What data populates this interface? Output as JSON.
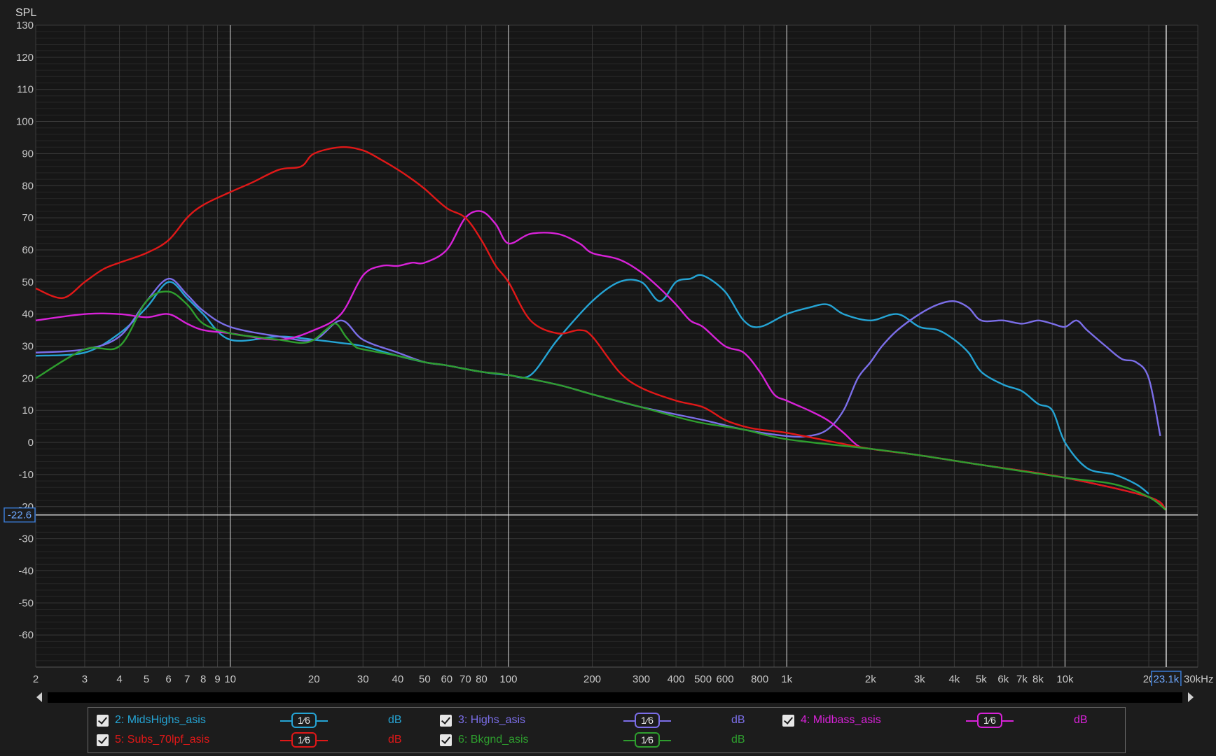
{
  "axis_label": "SPL",
  "cursor": {
    "y_readout": "-22.6",
    "x_readout": "23.1k",
    "y": -22.6,
    "x": 23100
  },
  "chart_data": {
    "type": "line",
    "title": "",
    "xlabel": "",
    "ylabel": "SPL",
    "x_scale": "log",
    "xlim": [
      2,
      30000
    ],
    "ylim": [
      -70,
      130
    ],
    "grid": true,
    "y_ticks": [
      130,
      120,
      110,
      100,
      90,
      80,
      70,
      60,
      50,
      40,
      30,
      20,
      10,
      0,
      -10,
      -20,
      -30,
      -40,
      -50,
      -60
    ],
    "x_ticks": [
      {
        "v": 2,
        "t": "2"
      },
      {
        "v": 3,
        "t": "3"
      },
      {
        "v": 4,
        "t": "4"
      },
      {
        "v": 5,
        "t": "5"
      },
      {
        "v": 6,
        "t": "6"
      },
      {
        "v": 7,
        "t": "7"
      },
      {
        "v": 8,
        "t": "8"
      },
      {
        "v": 9,
        "t": "9"
      },
      {
        "v": 10,
        "t": "10"
      },
      {
        "v": 20,
        "t": "20"
      },
      {
        "v": 30,
        "t": "30"
      },
      {
        "v": 40,
        "t": "40"
      },
      {
        "v": 50,
        "t": "50"
      },
      {
        "v": 60,
        "t": "60"
      },
      {
        "v": 70,
        "t": "70"
      },
      {
        "v": 80,
        "t": "80"
      },
      {
        "v": 100,
        "t": "100"
      },
      {
        "v": 200,
        "t": "200"
      },
      {
        "v": 300,
        "t": "300"
      },
      {
        "v": 400,
        "t": "400"
      },
      {
        "v": 500,
        "t": "500"
      },
      {
        "v": 600,
        "t": "600"
      },
      {
        "v": 800,
        "t": "800"
      },
      {
        "v": 1000,
        "t": "1k"
      },
      {
        "v": 2000,
        "t": "2k"
      },
      {
        "v": 3000,
        "t": "3k"
      },
      {
        "v": 4000,
        "t": "4k"
      },
      {
        "v": 5000,
        "t": "5k"
      },
      {
        "v": 6000,
        "t": "6k"
      },
      {
        "v": 7000,
        "t": "7k"
      },
      {
        "v": 8000,
        "t": "8k"
      },
      {
        "v": 10000,
        "t": "10k"
      },
      {
        "v": 20000,
        "t": "20"
      },
      {
        "v": 30000,
        "t": "30kHz"
      }
    ],
    "series": [
      {
        "name": "2: MidsHighs_asis",
        "color": "#25a4d4",
        "x": [
          2,
          3,
          4,
          5,
          6,
          7,
          8,
          10,
          15,
          20,
          25,
          30,
          40,
          50,
          60,
          80,
          100,
          120,
          150,
          200,
          250,
          300,
          350,
          400,
          450,
          500,
          600,
          700,
          800,
          1000,
          1200,
          1400,
          1600,
          2000,
          2500,
          3000,
          3500,
          4000,
          4500,
          5000,
          6000,
          7000,
          8000,
          9000,
          10000,
          12000,
          15000,
          18000,
          20000
        ],
        "y": [
          27,
          28,
          34,
          42,
          50,
          45,
          40,
          32,
          33,
          32,
          31,
          30,
          27,
          25,
          24,
          22,
          21,
          21,
          32,
          44,
          50,
          50,
          44,
          50,
          51,
          52,
          47,
          38,
          36,
          40,
          42,
          43,
          40,
          38,
          40,
          36,
          35,
          32,
          28,
          22,
          18,
          16,
          12,
          10,
          0,
          -8,
          -10,
          -13,
          -16
        ]
      },
      {
        "name": "3: Highs_asis",
        "color": "#7b6ee8",
        "x": [
          2,
          3,
          4,
          5,
          6,
          7,
          8,
          10,
          15,
          20,
          25,
          30,
          40,
          50,
          60,
          80,
          100,
          150,
          200,
          300,
          500,
          700,
          1000,
          1200,
          1400,
          1600,
          1800,
          2000,
          2200,
          2500,
          3000,
          3500,
          4000,
          4500,
          5000,
          6000,
          7000,
          8000,
          9000,
          10000,
          11000,
          12000,
          14000,
          16000,
          18000,
          20000,
          22000
        ],
        "y": [
          28,
          29,
          33,
          44,
          51,
          46,
          41,
          36,
          33,
          32,
          38,
          32,
          28,
          25,
          24,
          22,
          21,
          18,
          15,
          11,
          7,
          4,
          2,
          2,
          4,
          10,
          20,
          25,
          30,
          35,
          40,
          43,
          44,
          42,
          38,
          38,
          37,
          38,
          37,
          36,
          38,
          35,
          30,
          26,
          25,
          20,
          2
        ]
      },
      {
        "name": "4: Midbass_asis",
        "color": "#d822d8",
        "x": [
          2,
          3,
          4,
          5,
          6,
          7,
          8,
          10,
          15,
          20,
          25,
          30,
          35,
          40,
          45,
          50,
          60,
          70,
          80,
          90,
          100,
          120,
          150,
          180,
          200,
          250,
          300,
          350,
          400,
          450,
          500,
          600,
          700,
          800,
          900,
          1000,
          1200,
          1400,
          1600,
          1800,
          2000,
          3000,
          5000,
          10000,
          20000,
          23000
        ],
        "y": [
          38,
          40,
          40,
          39,
          40,
          37,
          35,
          34,
          32,
          35,
          40,
          52,
          55,
          55,
          56,
          56,
          60,
          70,
          72,
          68,
          62,
          65,
          65,
          62,
          59,
          57,
          53,
          48,
          43,
          38,
          36,
          30,
          28,
          22,
          15,
          13,
          10,
          7,
          3,
          -1,
          -2,
          -4,
          -7,
          -11,
          -17,
          -21
        ]
      },
      {
        "name": "5: Subs_70lpf_asis",
        "color": "#e01818",
        "x": [
          2,
          2.5,
          3,
          3.5,
          4,
          5,
          6,
          7,
          8,
          10,
          12,
          15,
          18,
          20,
          25,
          30,
          35,
          40,
          45,
          50,
          60,
          70,
          80,
          90,
          100,
          120,
          150,
          180,
          200,
          250,
          300,
          400,
          500,
          600,
          700,
          800,
          1000,
          1500,
          2000,
          3000,
          5000,
          10000,
          20000,
          23000
        ],
        "y": [
          48,
          45,
          50,
          54,
          56,
          59,
          63,
          70,
          74,
          78,
          81,
          85,
          86,
          90,
          92,
          91,
          88,
          85,
          82,
          79,
          73,
          70,
          63,
          55,
          50,
          38,
          34,
          35,
          33,
          22,
          17,
          13,
          11,
          7,
          5,
          4,
          3,
          0,
          -2,
          -4,
          -7,
          -11,
          -17,
          -21
        ]
      },
      {
        "name": "6: Bkgnd_asis",
        "color": "#2e9e2e",
        "x": [
          2,
          3,
          4,
          5,
          6,
          7,
          8,
          10,
          12,
          15,
          18,
          20,
          22,
          24,
          26,
          28,
          30,
          40,
          50,
          60,
          80,
          100,
          150,
          200,
          300,
          400,
          500,
          700,
          1000,
          2000,
          3000,
          5000,
          10000,
          15000,
          20000,
          23000
        ],
        "y": [
          20,
          29,
          30,
          44,
          47,
          43,
          37,
          34,
          33,
          32,
          31,
          32,
          35,
          37,
          33,
          30,
          29,
          27,
          25,
          24,
          22,
          21,
          18,
          15,
          11,
          8,
          6,
          4,
          1,
          -2,
          -4,
          -7,
          -11,
          -13,
          -17,
          -21
        ]
      }
    ]
  },
  "legend": [
    {
      "label": "2: MidsHighs_asis",
      "smoothing": "1⁄6",
      "unit": "dB",
      "color": "#25a4d4"
    },
    {
      "label": "3: Highs_asis",
      "smoothing": "1⁄6",
      "unit": "dB",
      "color": "#7b6ee8"
    },
    {
      "label": "4: Midbass_asis",
      "smoothing": "1⁄6",
      "unit": "dB",
      "color": "#d822d8"
    },
    {
      "label": "5: Subs_70lpf_asis",
      "smoothing": "1⁄6",
      "unit": "dB",
      "color": "#e01818"
    },
    {
      "label": "6: Bkgnd_asis",
      "smoothing": "1⁄6",
      "unit": "dB",
      "color": "#2e9e2e"
    }
  ]
}
